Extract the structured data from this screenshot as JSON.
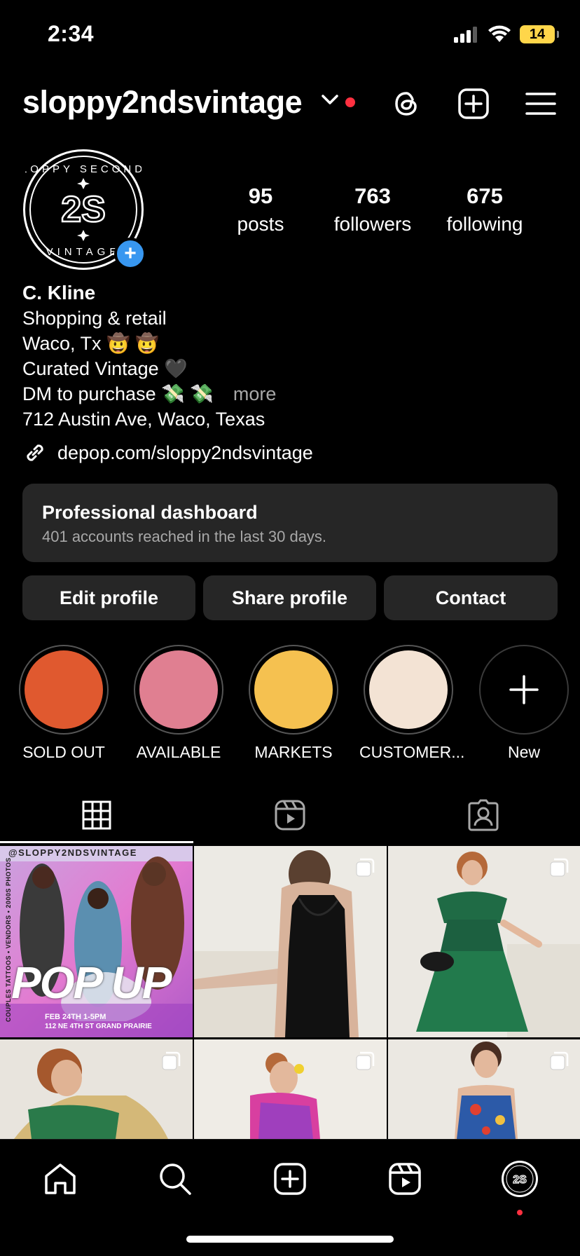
{
  "status": {
    "time": "2:34",
    "battery": "14"
  },
  "header": {
    "username": "sloppy2ndsvintage"
  },
  "stats": [
    {
      "num": "95",
      "label": "posts"
    },
    {
      "num": "763",
      "label": "followers"
    },
    {
      "num": "675",
      "label": "following"
    }
  ],
  "bio": {
    "name": "C. Kline",
    "category": "Shopping & retail",
    "line1": "Waco, Tx 🤠 🤠",
    "line2": "Curated Vintage 🖤",
    "line3": "DM to purchase 💸 💸",
    "more": "more",
    "address": "712 Austin Ave, Waco, Texas",
    "link": "depop.com/sloppy2ndsvintage"
  },
  "dashboard": {
    "title": "Professional dashboard",
    "subtitle": "401 accounts reached in the last 30 days."
  },
  "actions": {
    "edit": "Edit profile",
    "share": "Share profile",
    "contact": "Contact"
  },
  "highlights": [
    {
      "label": "SOLD OUT",
      "color": "#e0592f"
    },
    {
      "label": "AVAILABLE",
      "color": "#e07f91"
    },
    {
      "label": "MARKETS",
      "color": "#f5c150"
    },
    {
      "label": "CUSTOMER...",
      "color": "#f3e3d4"
    },
    {
      "label": "New",
      "color": ""
    }
  ],
  "posts": {
    "popup": {
      "handle": "@SLOPPY2NDSVINTAGE",
      "side_text": "COUPLES TATTOOS • VENDORS • 2000S PHOTOS",
      "title": "POP UP",
      "date": "FEB 24TH  1-5PM",
      "address": "112 NE 4TH ST GRAND PRAIRIE"
    }
  },
  "colors": {
    "accent_blue": "#3897f0",
    "live_red": "#ff3040",
    "card_bg": "#262626"
  }
}
